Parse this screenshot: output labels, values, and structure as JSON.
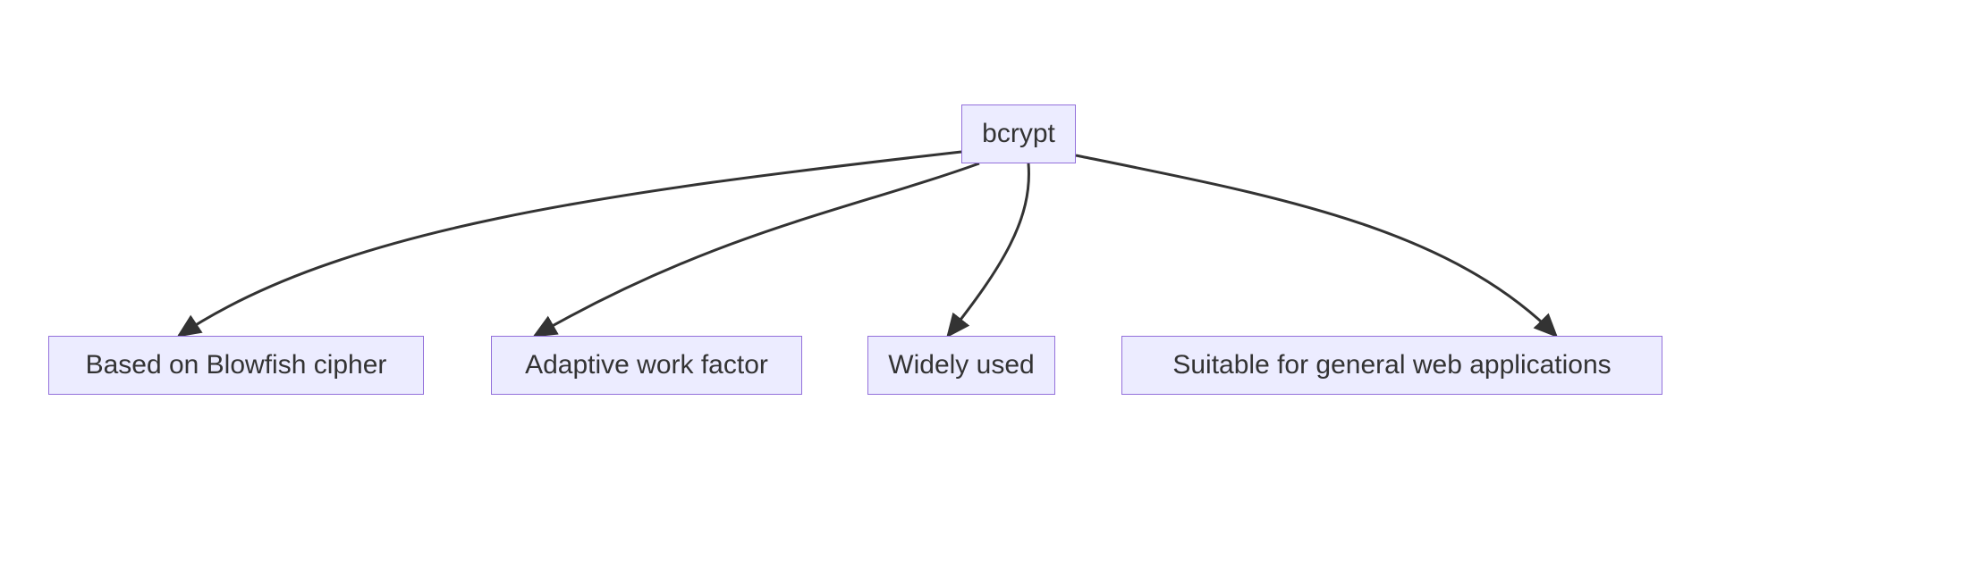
{
  "diagram": {
    "root": {
      "label": "bcrypt"
    },
    "leaves": [
      {
        "label": "Based on Blowfish cipher"
      },
      {
        "label": "Adaptive work factor"
      },
      {
        "label": "Widely used"
      },
      {
        "label": "Suitable for general web applications"
      }
    ],
    "edge_color": "#333333",
    "node_fill": "#ECECFF",
    "node_stroke": "#9370DB"
  }
}
